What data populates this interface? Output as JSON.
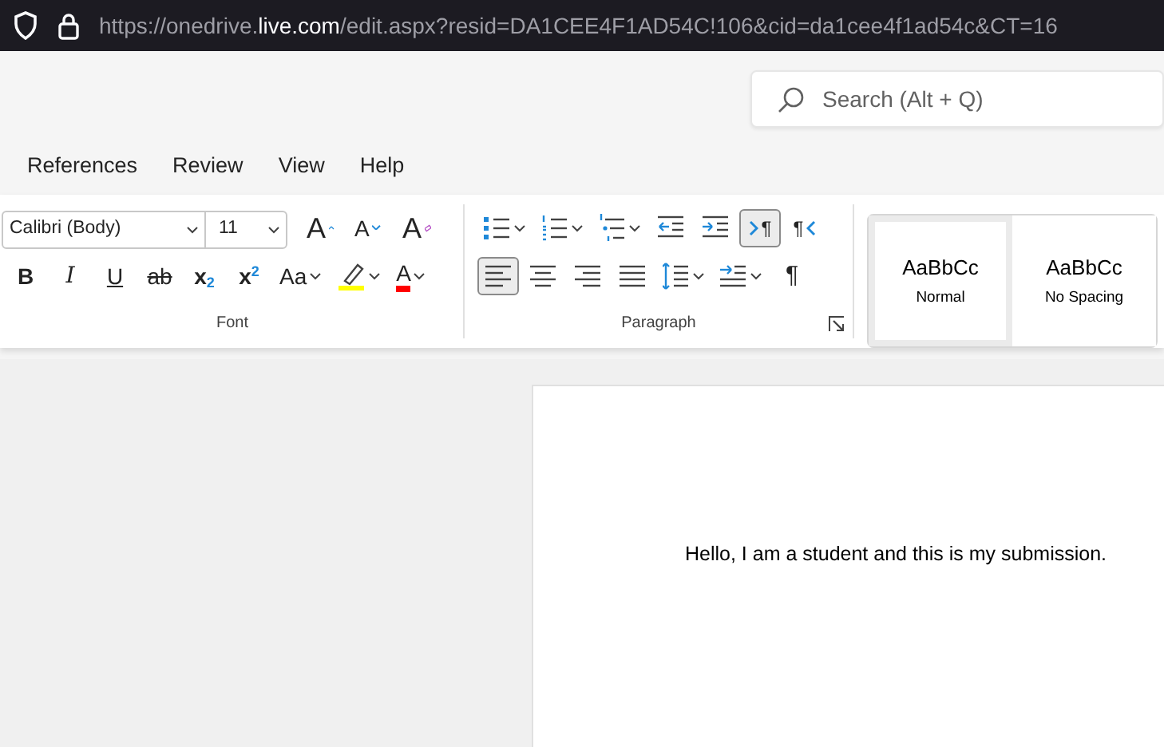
{
  "address_bar": {
    "prefix": "https://onedrive.",
    "domain": "live.com",
    "suffix": "/edit.aspx?resid=DA1CEE4F1AD54C!106&cid=da1cee4f1ad54c&CT=16"
  },
  "search": {
    "placeholder": "Search (Alt + Q)"
  },
  "menu_tabs": [
    "References",
    "Review",
    "View",
    "Help"
  ],
  "font_group": {
    "font_name": "Calibri (Body)",
    "font_size": "11",
    "label": "Font",
    "row_1": [
      {
        "kind": "grow",
        "label": "A"
      },
      {
        "kind": "shrink",
        "label": "A"
      },
      {
        "kind": "clear",
        "label": "A"
      }
    ],
    "row_2": [
      {
        "kind": "bold",
        "label": "B",
        "dropdown": false
      },
      {
        "kind": "italic",
        "label": "I",
        "dropdown": false
      },
      {
        "kind": "underline",
        "label": "U",
        "dropdown": false
      },
      {
        "kind": "strike",
        "label": "ab",
        "dropdown": false
      },
      {
        "kind": "script",
        "label": "x$_{2}$",
        "dropdown": false
      },
      {
        "kind": "script",
        "label": "x$^{2}$",
        "dropdown": false
      },
      {
        "kind": "case",
        "label": "Aa",
        "dropdown": true
      },
      {
        "kind": "highlight",
        "color": "#ffff00",
        "dropdown": true
      },
      {
        "kind": "fontcolor",
        "label": "A",
        "color": "#ff0000",
        "dropdown": true
      }
    ]
  },
  "paragraph_group": {
    "label": "Paragraph",
    "row_1": [
      {
        "kind": "bullets",
        "dropdown": true,
        "selected": false
      },
      {
        "kind": "numbering",
        "dropdown": true,
        "selected": false
      },
      {
        "kind": "multilevel",
        "dropdown": true,
        "selected": false
      },
      {
        "kind": "outdent",
        "dropdown": false,
        "selected": false
      },
      {
        "kind": "indent",
        "dropdown": false,
        "selected": false
      },
      {
        "kind": "ltr",
        "label": "¶",
        "dropdown": false,
        "selected": true
      },
      {
        "kind": "rtl",
        "label": "¶",
        "dropdown": false,
        "selected": false
      }
    ],
    "row_2": [
      {
        "kind": "align-left",
        "dropdown": false,
        "selected": true
      },
      {
        "kind": "align-center",
        "dropdown": false,
        "selected": false
      },
      {
        "kind": "align-right",
        "dropdown": false,
        "selected": false
      },
      {
        "kind": "justify",
        "dropdown": false,
        "selected": false
      },
      {
        "kind": "spacing",
        "dropdown": true,
        "selected": false
      },
      {
        "kind": "para-indent",
        "dropdown": true,
        "selected": false
      },
      {
        "kind": "marks",
        "label": "¶",
        "dropdown": false,
        "selected": false
      }
    ]
  },
  "styles": [
    {
      "preview": "AaBbCc",
      "name": "Normal",
      "selected": true
    },
    {
      "preview": "AaBbCc",
      "name": "No Spacing",
      "selected": false
    }
  ],
  "document": {
    "text": "Hello, I am a student and this is my submission."
  }
}
